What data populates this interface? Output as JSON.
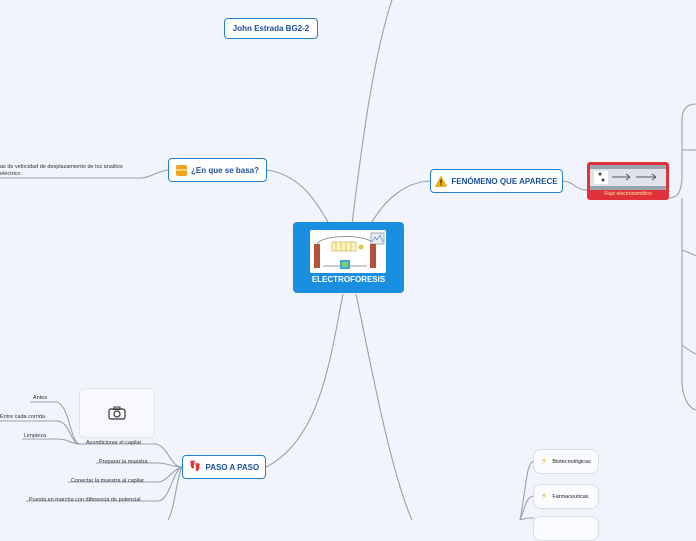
{
  "author": "John Estrada BG2-2",
  "central": {
    "title": "ELECTROFORESIS",
    "image_icon": "electrophoresis-apparatus-diagram"
  },
  "nodes": {
    "basa": {
      "label": "¿En que se basa?",
      "icon": "box-icon"
    },
    "basa_text_line1": "as de velocidad de desplazamiento de los analitos",
    "basa_text_line2": "eléctrico.",
    "fenomeno": {
      "label": "FENÓMENO QUE APARECE",
      "icon": "warning-icon"
    },
    "fenomeno_image": {
      "icon": "electroosmotic-flow-image",
      "caption": "Flujo electroosmótico"
    },
    "paso": {
      "label": "PASO A PASO",
      "icon": "footprints-icon"
    }
  },
  "pasos": {
    "antes": "Antes",
    "entre": "Entre cada corrida",
    "limpieza": "Limpieza",
    "acondicionar": "Acondicionar el capilar",
    "preparar": "Preparar la muestra",
    "conectar": "Conectar la muestra al capilar",
    "puesta": "Puesta en marcha con diferencia de potencial",
    "photo_icon": "camera-icon"
  },
  "aplicaciones": [
    {
      "label": "Biotecnológicas",
      "icon": "lightning-icon"
    },
    {
      "label": "Farmaceuticas",
      "icon": "lightning-icon"
    }
  ],
  "colors": {
    "background": "#f1f4fb",
    "central_fill": "#1a8fe0",
    "node_border": "#1f7fd1",
    "node_text": "#1a4f9c",
    "connector": "#9aa0aa",
    "image_frame": "#e0323a"
  }
}
